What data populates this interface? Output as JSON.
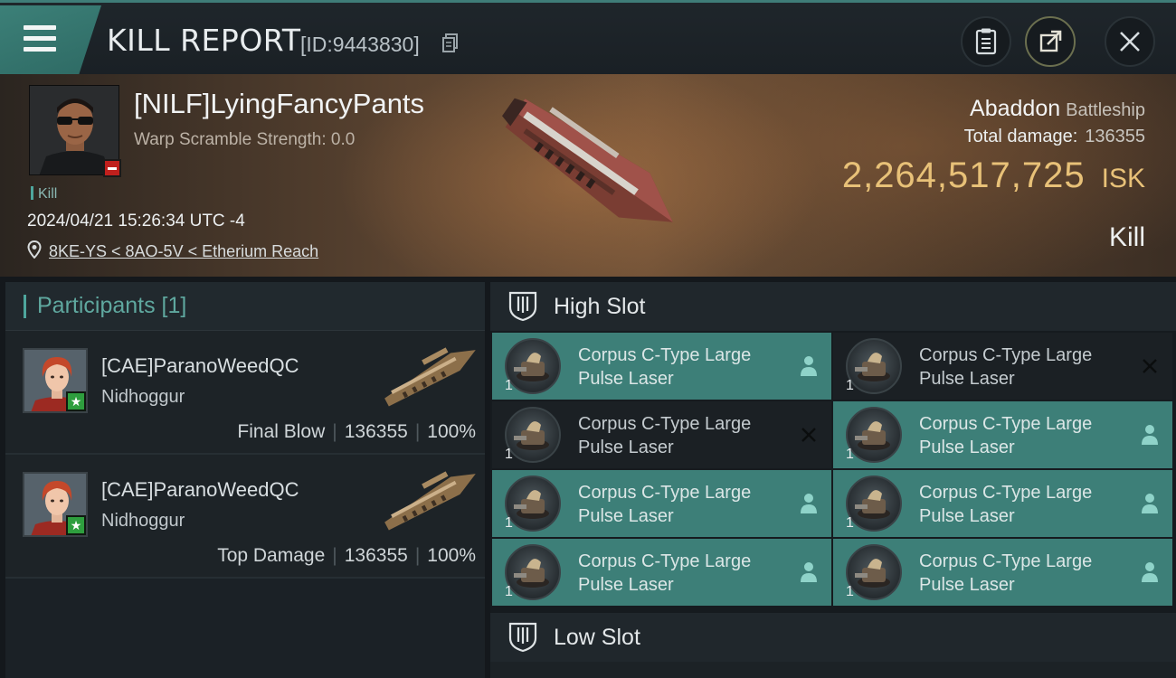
{
  "header": {
    "title": "KILL REPORT",
    "report_id": "[ID:9443830]"
  },
  "victim": {
    "name": "[NILF]LyingFancyPants",
    "warp_scramble": "Warp Scramble Strength: 0.0",
    "kill_tag": "Kill",
    "timestamp": "2024/04/21 15:26:34 UTC -4",
    "location": "8KE-YS < 8AO-5V < Etherium Reach",
    "ship_name": "Abaddon",
    "ship_class": "Battleship",
    "total_damage_label": "Total damage:",
    "total_damage": "136355",
    "isk_value": "2,264,517,725",
    "isk_currency": "ISK",
    "result": "Kill"
  },
  "participants": {
    "header": "Participants [1]",
    "rows": [
      {
        "name": "[CAE]ParanoWeedQC",
        "ship": "Nidhoggur",
        "role": "Final Blow",
        "damage": "136355",
        "percent": "100%"
      },
      {
        "name": "[CAE]ParanoWeedQC",
        "ship": "Nidhoggur",
        "role": "Top Damage",
        "damage": "136355",
        "percent": "100%"
      }
    ]
  },
  "fittings": {
    "high_slot_label": "High Slot",
    "low_slot_label": "Low Slot",
    "high_modules": [
      {
        "line1": "Corpus C-Type Large",
        "line2": "Pulse Laser",
        "qty": "1",
        "state": "dropped"
      },
      {
        "line1": "Corpus C-Type Large",
        "line2": "Pulse Laser",
        "qty": "1",
        "state": "destroyed"
      },
      {
        "line1": "Corpus C-Type Large",
        "line2": "Pulse Laser",
        "qty": "1",
        "state": "destroyed"
      },
      {
        "line1": "Corpus C-Type Large",
        "line2": "Pulse Laser",
        "qty": "1",
        "state": "dropped"
      },
      {
        "line1": "Corpus C-Type Large",
        "line2": "Pulse Laser",
        "qty": "1",
        "state": "dropped"
      },
      {
        "line1": "Corpus C-Type Large",
        "line2": "Pulse Laser",
        "qty": "1",
        "state": "dropped"
      },
      {
        "line1": "Corpus C-Type Large",
        "line2": "Pulse Laser",
        "qty": "1",
        "state": "dropped"
      },
      {
        "line1": "Corpus C-Type Large",
        "line2": "Pulse Laser",
        "qty": "1",
        "state": "dropped"
      }
    ]
  },
  "icons": {
    "menu": "hamburger-menu-icon",
    "copy": "copy-icon",
    "clipboard": "clipboard-icon",
    "share": "share-icon",
    "close": "close-icon",
    "location": "location-pin-icon",
    "slot": "slot-shield-icon",
    "dropped": "person-icon",
    "destroyed": "x-mark-icon"
  },
  "colors": {
    "accent_teal": "#3d7f78",
    "isk_gold": "#e8c178",
    "victim_badge_red": "#c0201d",
    "attacker_badge_green": "#2e9e3e"
  }
}
